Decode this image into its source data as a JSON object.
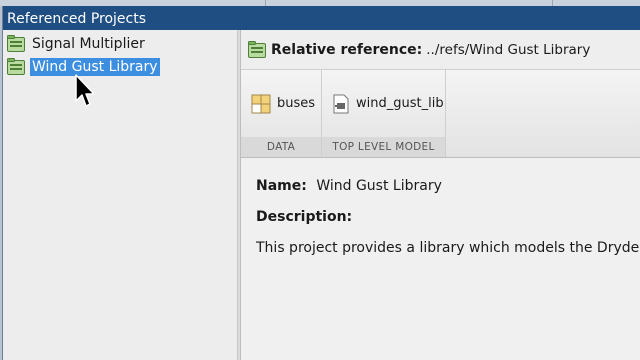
{
  "window": {
    "title": "Referenced Projects"
  },
  "tree": {
    "items": [
      {
        "label": "Signal Multiplier",
        "selected": false
      },
      {
        "label": "Wind Gust Library",
        "selected": true
      }
    ]
  },
  "reference": {
    "label": "Relative reference:",
    "path": "../refs/Wind Gust Library"
  },
  "ribbon": {
    "sections": [
      {
        "label": "DATA",
        "items": [
          {
            "label": "buses",
            "icon": "grid-icon"
          }
        ]
      },
      {
        "label": "TOP LEVEL MODEL",
        "items": [
          {
            "label": "wind_gust_lib",
            "icon": "model-icon"
          }
        ]
      }
    ]
  },
  "details": {
    "name_label": "Name:",
    "name_value": "Wind Gust Library",
    "description_label": "Description:",
    "description_text": "This project provides a library which models the Dryden wi"
  },
  "colors": {
    "titlebar": "#1f4f82",
    "selection": "#3c8ee0",
    "project_icon_green": "#79b35a"
  }
}
